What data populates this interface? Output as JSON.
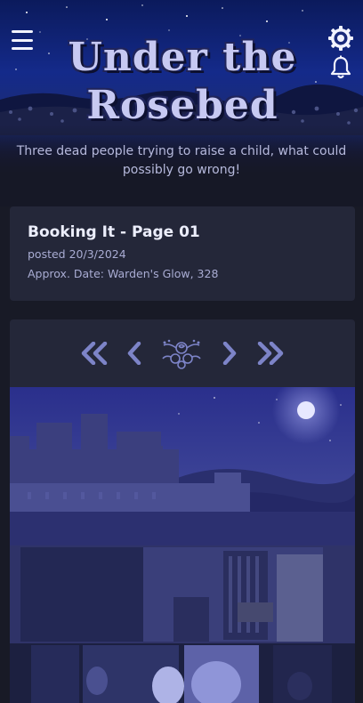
{
  "header": {
    "title_line1": "Under the",
    "title_line2": "Rosebed",
    "tagline": "Three dead people trying to raise a child, what could possibly go wrong!",
    "menu_icon": "hamburger-menu-icon",
    "settings_icon": "gear-icon",
    "notifications_icon": "bell-icon"
  },
  "post": {
    "title": "Booking It - Page 01",
    "posted": "posted 20/3/2024",
    "approx_date": "Approx. Date: Warden's Glow, 328"
  },
  "navigation": {
    "first_icon": "double-chevron-left-icon",
    "prev_icon": "chevron-left-icon",
    "home_icon": "rose-emblem-icon",
    "next_icon": "chevron-right-icon",
    "last_icon": "double-chevron-right-icon"
  },
  "colors": {
    "background": "#181a26",
    "card": "#242739",
    "accent": "#7d84c8",
    "banner_sky": "#142a8a",
    "title": "#c7c9f2"
  }
}
